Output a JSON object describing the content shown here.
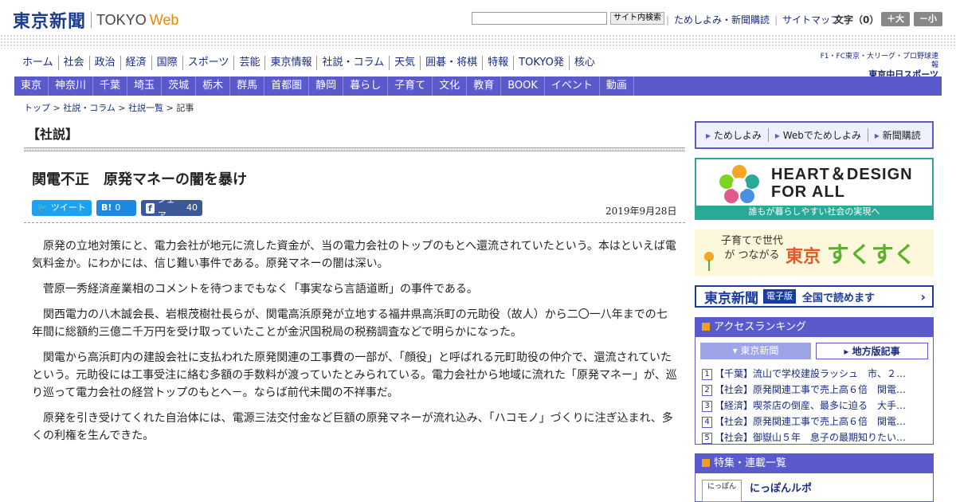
{
  "header": {
    "logo_jp": "東京新聞",
    "logo_en": "TOKYO",
    "logo_web": "Web",
    "search_button": "サイト内検索",
    "links": [
      "ためしよみ・新聞購読",
      "サイトマップ"
    ],
    "fontsize_label": "文字（0）",
    "font_bigger": "＋大",
    "font_smaller": "－小"
  },
  "nav_primary": [
    "ホーム",
    "社会",
    "政治",
    "経済",
    "国際",
    "スポーツ",
    "芸能",
    "東京情報",
    "社説・コラム",
    "天気",
    "囲碁・将棋",
    "特報",
    "TOKYO発",
    "核心"
  ],
  "sports": {
    "line": "F1・FC東京・大リーグ・プロ野球速報",
    "logo": "東京中日スポーツ"
  },
  "nav_secondary": [
    "東京",
    "神奈川",
    "千葉",
    "埼玉",
    "茨城",
    "栃木",
    "群馬",
    "首都圏",
    "静岡",
    "暮らし",
    "子育て",
    "文化",
    "教育",
    "BOOK",
    "イベント",
    "動画"
  ],
  "breadcrumb": {
    "items": [
      "トップ",
      "社説・コラム",
      "社説一覧"
    ],
    "current": "記事"
  },
  "article": {
    "section": "【社説】",
    "headline": "関電不正　原発マネーの闇を暴け",
    "share": {
      "tweet": "ツイート",
      "hatena": "B!",
      "hatena_count": "0",
      "fb": "シェア",
      "fb_count": "40"
    },
    "date": "2019年9月28日",
    "paragraphs": [
      "原発の立地対策にと、電力会社が地元に流した資金が、当の電力会社のトップのもとへ還流されていたという。本はといえば電気料金か。にわかには、信じ難い事件である。原発マネーの闇は深い。",
      "菅原一秀経済産業相のコメントを待つまでもなく「事実なら言語道断」の事件である。",
      "関西電力の八木誠会長、岩根茂樹社長らが、関電高浜原発が立地する福井県高浜町の元助役（故人）から二〇一八年までの七年間に総額約三億二千万円を受け取っていたことが金沢国税局の税務調査などで明らかになった。",
      "関電から高浜町内の建設会社に支払われた原発関連の工事費の一部が、「顔役」と呼ばれる元町助役の仲介で、還流されていたという。元助役には工事受注に絡む多額の手数料が渡っていたとみられている。電力会社から地域に流れた「原発マネー」が、巡り巡って電力会社の経営トップのもとへ－。ならば前代未聞の不祥事だ。",
      "原発を引き受けてくれた自治体には、電源三法交付金など巨額の原発マネーが流れ込み、「ハコモノ」づくりに注ぎ込まれ、多くの利権を生んできた。"
    ]
  },
  "sidebar": {
    "tameshi": [
      "ためしよみ",
      "Webでためしよみ",
      "新聞購読"
    ],
    "heart_title": "HEART＆DESIGN FOR ALL",
    "heart_sub": "誰もが暮らしやすい社会の実現へ",
    "suku_small": "子育てで世代が つながる",
    "suku_tokyo": "東京",
    "suku_big": "すくすく",
    "denshi_logo": "東京新聞",
    "denshi_tag": "電子版",
    "denshi_text": "全国で読めます",
    "ranking_title": "アクセスランキング",
    "ranking_tabs": [
      "東京新聞",
      "地方版記事"
    ],
    "ranking_items": [
      "【千葉】流山で学校建設ラッシュ　市、２…",
      "【社会】原発関連工事で売上高６倍　関電…",
      "【経済】喫茶店の倒産、最多に迫る　大手…",
      "【社会】原発関連工事で売上高６倍　関電…",
      "【社会】御嶽山５年　息子の最期知りたい…"
    ],
    "tokushu_title": "特集・連載一覧",
    "tokushu_item": "にっぽんルポ",
    "tokushu_thumb": "にっぽん"
  }
}
